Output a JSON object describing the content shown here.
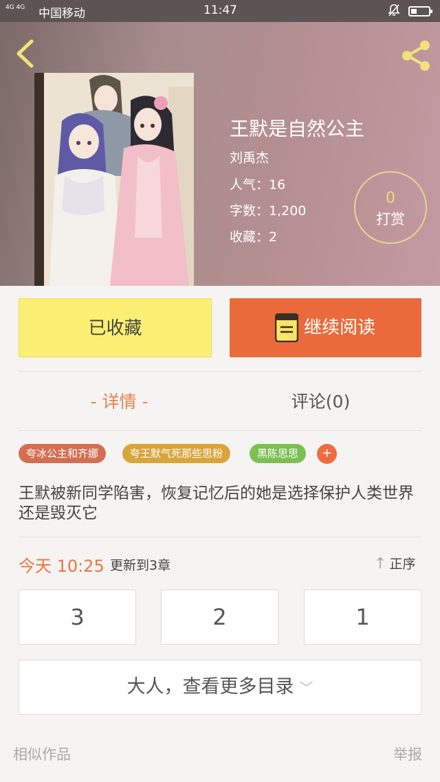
{
  "status_bar": {
    "signal": "4G 4G",
    "carrier": "中国移动",
    "time": "11:47"
  },
  "book": {
    "title": "王默是自然公主",
    "author": "刘禹杰",
    "popularity": "人气：16",
    "word_count": "字数：1,200",
    "favorites": "收藏：2",
    "tip_count": "0",
    "tip_label": "打赏"
  },
  "actions": {
    "collected_label": "已收藏",
    "read_label": "继续阅读"
  },
  "tabs": {
    "detail": "- 详情 -",
    "comments": "评论(0)"
  },
  "tags": [
    "夸冰公主和齐娜",
    "夸王默气死那些思粉",
    "黑陈思思"
  ],
  "tag_add": "+",
  "summary": "王默被新同学陷害，恢复记忆后的她是选择保护人类世界还是毁灭它",
  "update": {
    "time": "今天 10:25",
    "text": "更新到3章",
    "sort_label": "正序",
    "sort_icon": "↑"
  },
  "chapters": [
    "3",
    "2",
    "1"
  ],
  "more_label": "大人，查看更多目录",
  "more_icon": "﹀",
  "footer": {
    "similar": "相似作品",
    "report": "举报"
  },
  "colors": {
    "accent": "#ea6a3b",
    "collected_bg": "#fbf073",
    "tab_active": "#ef7e4c",
    "tip_count": "#f1d877"
  },
  "icons": [
    "back-arrow-icon",
    "share-icon",
    "book-icon",
    "sort-arrow-icon",
    "chevron-down-icon",
    "bell-off-icon",
    "battery-icon",
    "signal-icon"
  ]
}
